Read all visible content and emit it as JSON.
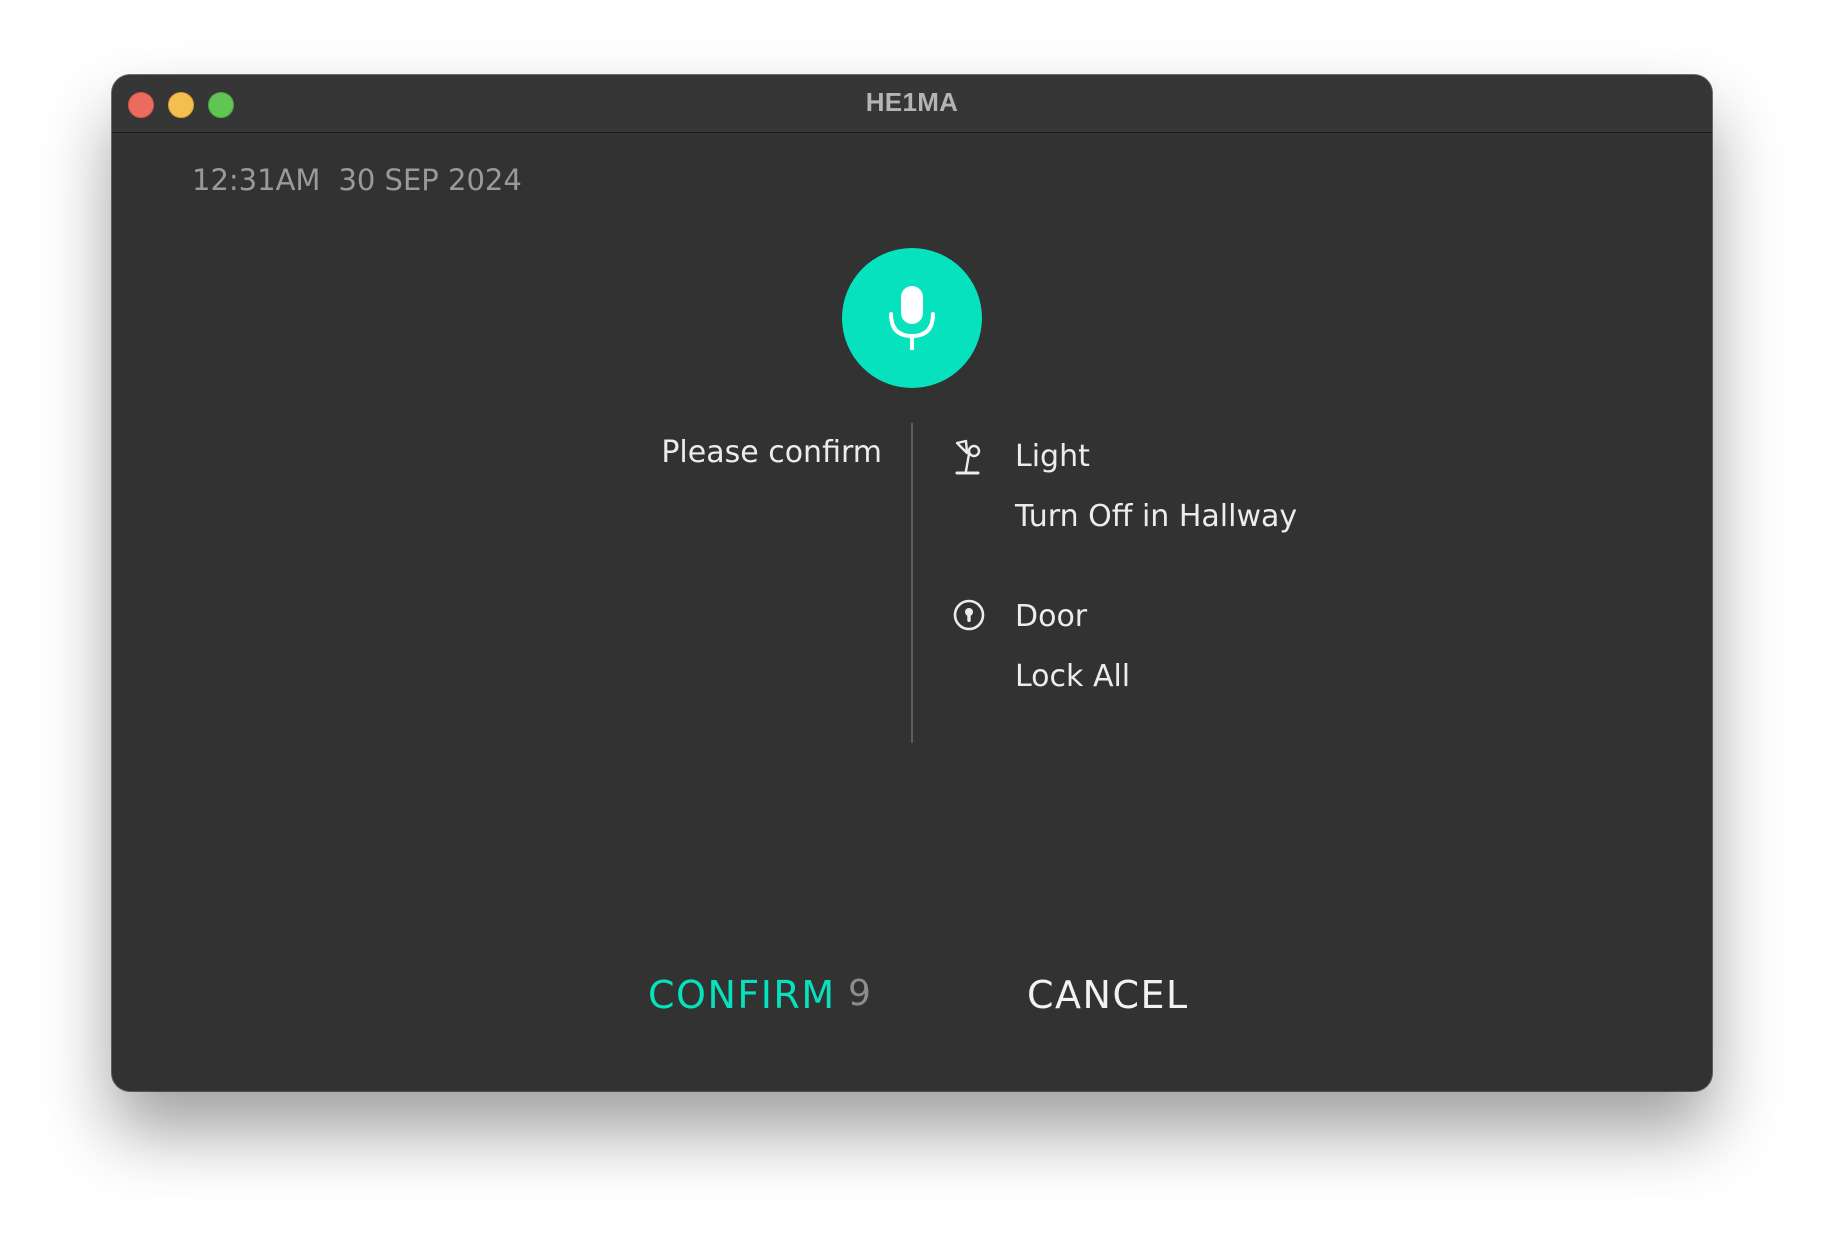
{
  "window": {
    "title": "HE1MA"
  },
  "status": {
    "time": "12:31AM",
    "date": "30 SEP 2024"
  },
  "voice": {
    "icon": "microphone-icon",
    "accent_color": "#06e2bd"
  },
  "prompt": "Please confirm",
  "commands": [
    {
      "icon": "desk-lamp-icon",
      "title": "Light",
      "action": "Turn Off in Hallway"
    },
    {
      "icon": "door-lock-icon",
      "title": "Door",
      "action": "Lock All"
    }
  ],
  "actions": {
    "confirm_label": "CONFIRM",
    "countdown": "9",
    "cancel_label": "CANCEL"
  },
  "colors": {
    "background": "#323232",
    "accent": "#06e2bd",
    "text": "#ececec",
    "muted": "#9a9a9a"
  }
}
